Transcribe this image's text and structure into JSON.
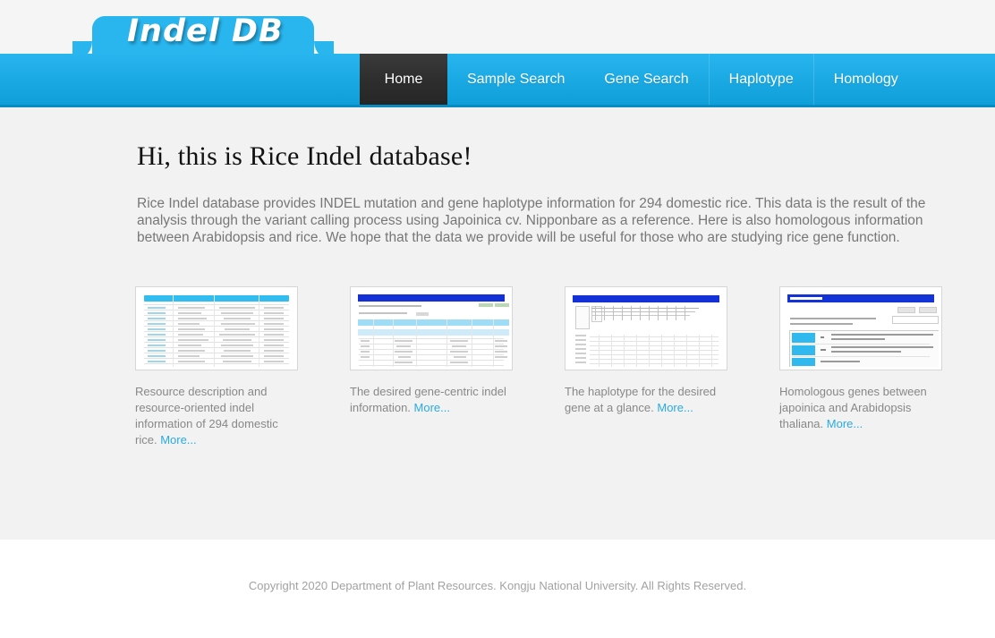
{
  "site": {
    "logo_text": "Indel DB"
  },
  "nav": {
    "items": [
      {
        "label": "Home",
        "active": true
      },
      {
        "label": "Sample Search",
        "active": false
      },
      {
        "label": "Gene Search",
        "active": false
      },
      {
        "label": "Haplotype",
        "active": false
      },
      {
        "label": "Homology",
        "active": false
      }
    ]
  },
  "main": {
    "title": "Hi, this is Rice Indel database!",
    "intro": "Rice Indel database provides INDEL mutation and gene haplotype information for 294 domestic rice. This data is the result of the analysis through the variant calling process using Japoinica cv. Nipponbare as a reference. Here is also homologous information between Arabidopsis and rice. We hope that the data we provide will be useful for those who are studying rice gene function.",
    "cards": [
      {
        "thumb_name": "sample-table-thumbnail",
        "caption": "Resource description and resource-oriented indel information of 294 domestic rice.",
        "more_label": "More..."
      },
      {
        "thumb_name": "gene-search-table-thumbnail",
        "caption": "The desired gene-centric indel information.",
        "more_label": "More..."
      },
      {
        "thumb_name": "haplotype-matrix-thumbnail",
        "caption": "The haplotype for the desired gene at a glance.",
        "more_label": "More..."
      },
      {
        "thumb_name": "homology-result-thumbnail",
        "caption": "Homologous genes between japoinica and Arabidopsis thaliana.",
        "more_label": "More..."
      }
    ]
  },
  "footer": {
    "copyright": "Copyright 2020 Department of Plant Resources. Kongju National University. All Rights Reserved."
  },
  "colors": {
    "brand_blue": "#29b6ef",
    "nav_active": "#2e2e2e",
    "link_blue": "#29abe2",
    "content_bg": "#f2f2f2",
    "body_text": "#777777"
  }
}
